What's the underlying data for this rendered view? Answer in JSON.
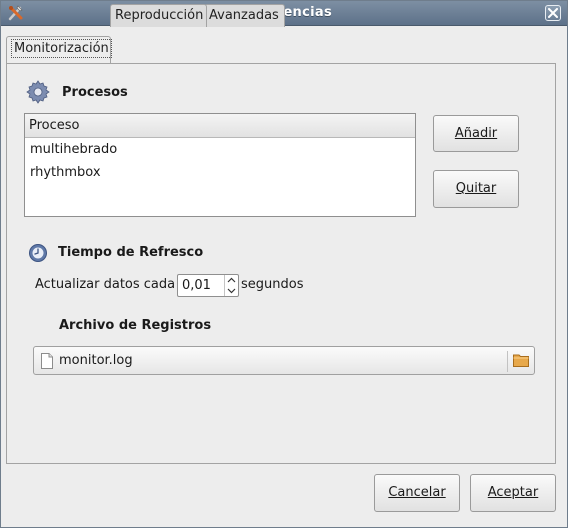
{
  "window": {
    "title": "Preferencias"
  },
  "tabs": [
    "Monitorización",
    "Reproducción",
    "Avanzadas"
  ],
  "procesos": {
    "heading": "Procesos",
    "column_header": "Proceso",
    "rows": [
      "multihebrado",
      "rhythmbox"
    ],
    "add_button": "Añadir",
    "remove_button": "Quitar"
  },
  "refresco": {
    "heading": "Tiempo de Refresco",
    "label_before": "Actualizar datos cada",
    "value": "0,01",
    "label_after": "segundos"
  },
  "registros": {
    "heading": "Archivo de Registros",
    "filename": "monitor.log"
  },
  "footer": {
    "cancel": "Cancelar",
    "accept": "Aceptar"
  },
  "icons": {
    "app": "preferences-tools-icon",
    "close": "close-icon",
    "procesos": "gear-icon",
    "refresco": "clock-icon",
    "file": "document-icon",
    "folder": "folder-icon"
  },
  "colors": {
    "titlebar": "#6a7e95",
    "window_bg": "#ededed"
  }
}
